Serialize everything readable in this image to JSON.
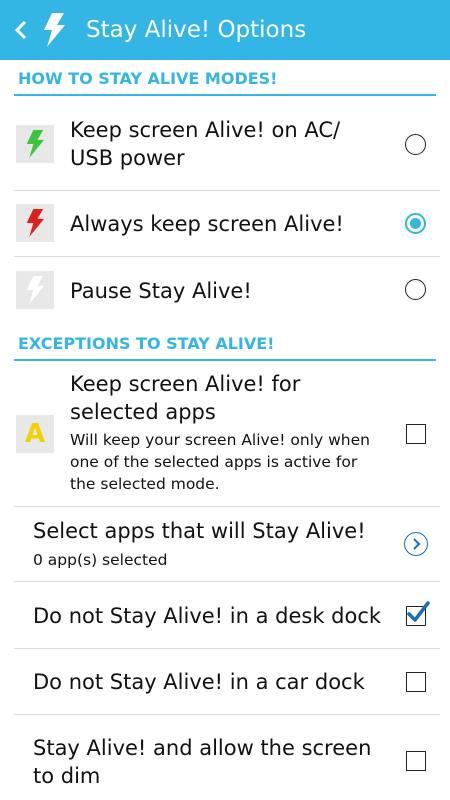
{
  "header": {
    "title": "Stay Alive! Options"
  },
  "sections": {
    "modes_title": "HOW TO STAY ALIVE MODES!",
    "exceptions_title": "EXCEPTIONS TO STAY ALIVE!"
  },
  "modes": [
    {
      "label_line1": "Keep screen Alive! on AC/",
      "label_line2": "USB power",
      "selected": false,
      "icon": "green-bolt-icon",
      "icon_color": "#3ec43e"
    },
    {
      "label": "Always keep screen Alive!",
      "selected": true,
      "icon": "red-bolt-icon",
      "icon_color": "#e02020"
    },
    {
      "label": "Pause Stay Alive!",
      "selected": false,
      "icon": "white-bolt-icon",
      "icon_color": "#ffffff"
    }
  ],
  "exceptions": {
    "selected_apps": {
      "title_line1": "Keep screen Alive! for",
      "title_line2": "selected apps",
      "summary_line1": "Will keep your screen Alive! only when",
      "summary_line2": "one of the selected apps is active for",
      "summary_line3": "the selected mode.",
      "icon_letter": "A",
      "checked": false
    },
    "select_apps": {
      "title": "Select apps that will Stay Alive!",
      "summary": "0 app(s) selected"
    },
    "desk_dock": {
      "title": "Do not Stay Alive! in a desk dock",
      "checked": true
    },
    "car_dock": {
      "title": "Do not Stay Alive! in a car dock",
      "checked": false
    },
    "allow_dim": {
      "title_line1": "Stay Alive! and allow the screen",
      "title_line2": "to dim",
      "checked": false
    }
  },
  "colors": {
    "accent": "#33b5e5",
    "checkmark": "#1a6fb0"
  }
}
